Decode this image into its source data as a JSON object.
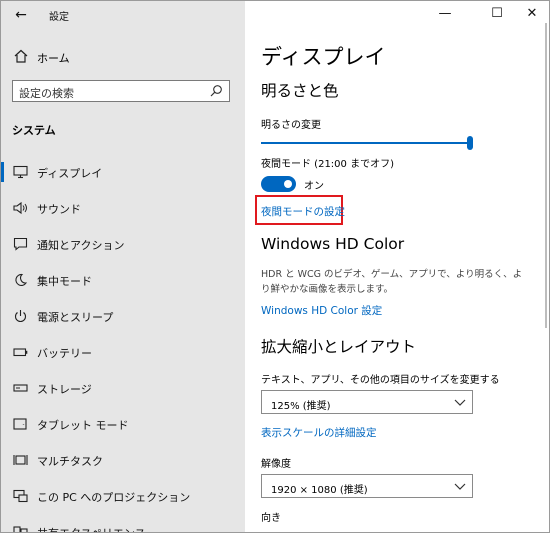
{
  "window": {
    "title": "設定",
    "back_glyph": "←",
    "minimize": "—",
    "maximize": "☐",
    "close": "✕"
  },
  "sidebar": {
    "home_label": "ホーム",
    "search_placeholder": "設定の検索",
    "section_title": "システム",
    "items": [
      {
        "label": "ディスプレイ",
        "icon": "monitor-icon",
        "active": true
      },
      {
        "label": "サウンド",
        "icon": "speaker-icon"
      },
      {
        "label": "通知とアクション",
        "icon": "notification-icon"
      },
      {
        "label": "集中モード",
        "icon": "moon-icon"
      },
      {
        "label": "電源とスリープ",
        "icon": "power-icon"
      },
      {
        "label": "バッテリー",
        "icon": "battery-icon"
      },
      {
        "label": "ストレージ",
        "icon": "storage-icon"
      },
      {
        "label": "タブレット モード",
        "icon": "tablet-icon"
      },
      {
        "label": "マルチタスク",
        "icon": "multitask-icon"
      },
      {
        "label": "この PC へのプロジェクション",
        "icon": "projection-icon"
      },
      {
        "label": "共有エクスペリエンス",
        "icon": "shared-icon"
      }
    ]
  },
  "main": {
    "page_title": "ディスプレイ",
    "brightness_section": "明るさと色",
    "brightness_label": "明るさの変更",
    "brightness_level": 1.0,
    "night_mode_label": "夜間モード (21:00 までオフ)",
    "night_toggle_label": "オン",
    "night_settings_link": "夜間モードの設定",
    "hdr_title": "Windows HD Color",
    "hdr_desc": "HDR と WCG のビデオ、ゲーム、アプリで、より明るく、より鮮やかな画像を表示します。",
    "hdr_link": "Windows HD Color 設定",
    "scale_section": "拡大縮小とレイアウト",
    "scale_label": "テキスト、アプリ、その他の項目のサイズを変更する",
    "scale_value": "125% (推奨)",
    "scale_advanced_link": "表示スケールの詳細設定",
    "resolution_label": "解像度",
    "resolution_value": "1920 × 1080 (推奨)",
    "orientation_label": "向き"
  },
  "colors": {
    "accent": "#0067c0",
    "highlight": "#e0191e",
    "sidebar_bg": "#e6e6e6"
  }
}
